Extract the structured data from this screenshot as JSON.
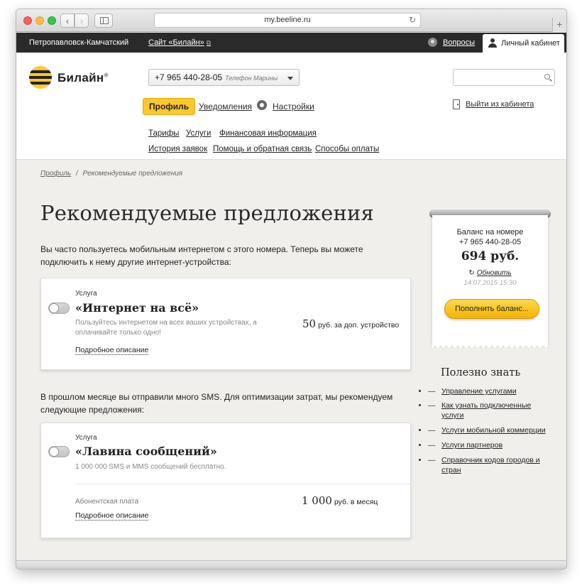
{
  "browser": {
    "url": "my.beeline.ru",
    "back_glyph": "‹",
    "forward_glyph": "›",
    "reload_glyph": "↻",
    "new_tab_glyph": "+"
  },
  "topbar": {
    "city": "Петропавловск-Камчатский",
    "site_link": "Сайт «Билайн»",
    "external_glyph": "⧉",
    "faq": "Вопросы",
    "cabinet": "Личный кабинет"
  },
  "header": {
    "brand": "Билайн",
    "brand_mark": "®",
    "phone": "+7 965 440-28-05",
    "phone_owner": "Телефон Марины",
    "search_placeholder": "",
    "nav_primary": {
      "profile": "Профиль",
      "notifications": "Уведомления",
      "settings": "Настройки"
    },
    "logout": "Выйти из кабинета",
    "nav_secondary": [
      "Тарифы",
      "Услуги",
      "Финансовая информация"
    ],
    "nav_tertiary": [
      "История заявок",
      "Помощь и обратная связь",
      "Способы оплаты"
    ]
  },
  "breadcrumb": {
    "root": "Профиль",
    "separator": "/",
    "current": "Рекомендуемые предложения"
  },
  "page_title": "Рекомендуемые предложения",
  "intro1": "Вы часто пользуетесь мобильным интернетом с этого номера. Теперь вы можете подключить к нему другие интернет-устройства:",
  "offer1": {
    "type": "Услуга",
    "name": "«Интернет на всё»",
    "description": "Пользуйтесь интернетом на всех ваших устройствах, а оплачивайте только одно!",
    "price": "50",
    "price_unit": "руб. за доп. устройство",
    "more": "Подробное описание",
    "enabled": false
  },
  "intro2": "В прошлом месяце вы отправили много SMS. Для оптимизации затрат, мы рекомендуем следующие предложения:",
  "offer2": {
    "type": "Услуга",
    "name": "«Лавина сообщений»",
    "description": "1 000 000 SMS и MMS сообщений бесплатно.",
    "fee_label": "Абонентская плата",
    "price": "1 000",
    "price_unit": "руб. в месяц",
    "more": "Подробное описание",
    "enabled": false
  },
  "balance": {
    "label": "Баланс на номере",
    "phone": "+7 965 440-28-05",
    "amount": "694 руб.",
    "refresh_glyph": "↻",
    "refresh": "Обновить",
    "date": "14.07.2015 15:30",
    "topup": "Пополнить баланс..."
  },
  "useful": {
    "title": "Полезно знать",
    "links": [
      "Управление услугами",
      "Как узнать подключенные услуги",
      "Услуги мобильной коммерции",
      "Услуги партнеров",
      "Справочник кодов городов и стран"
    ]
  },
  "colors": {
    "brand_yellow": "#fdc72f",
    "topbar_black": "#2a2a2a",
    "page_bg": "#f1efec"
  }
}
